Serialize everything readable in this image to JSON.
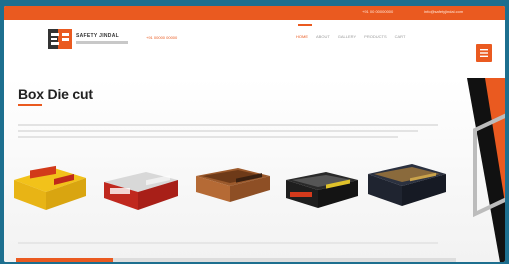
{
  "colors": {
    "accent": "#ea5a20",
    "frame_bg": "#1d6f8f",
    "dark": "#1a1a1a"
  },
  "topbar": {
    "phone": "+91 00 00000000",
    "email": "info@safetyjindal.com"
  },
  "header": {
    "brand": "SAFETY JINDAL",
    "phone_label": "+91 00000 00000",
    "nav": [
      "HOME",
      "ABOUT",
      "GALLERY",
      "PRODUCTS",
      "CART"
    ],
    "menu_icon": "menu-icon"
  },
  "main": {
    "title": "Box Die cut"
  },
  "products": [
    {
      "name": "yellow-box",
      "icon": "product-image"
    },
    {
      "name": "red-box",
      "icon": "product-image"
    },
    {
      "name": "brown-tray",
      "icon": "product-image"
    },
    {
      "name": "dark-tray",
      "icon": "product-image"
    },
    {
      "name": "black-box",
      "icon": "product-image"
    }
  ]
}
